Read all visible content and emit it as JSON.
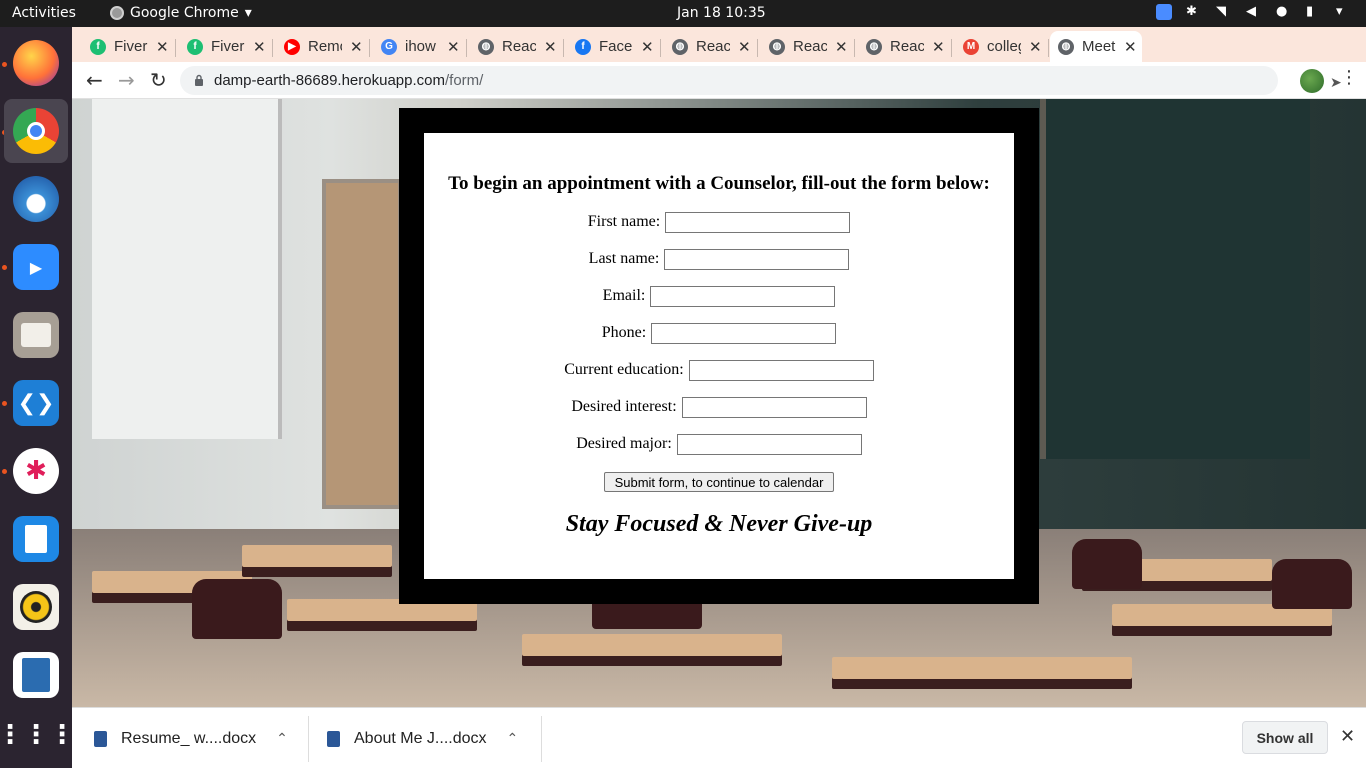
{
  "topbar": {
    "activities": "Activities",
    "app_name": "Google Chrome",
    "clock": "Jan 18  10:35"
  },
  "dock": {
    "items": [
      "firefox",
      "chrome",
      "thunderbird",
      "zoom",
      "files",
      "vscode",
      "slack",
      "whiteboard",
      "rhythmbox",
      "writer",
      "show-apps"
    ]
  },
  "tabs": [
    {
      "label": "Fiverr",
      "icon": "fiverr-icon",
      "color": "#1dbf73",
      "active": false
    },
    {
      "label": "Fiverr",
      "icon": "fiverr-icon",
      "color": "#1dbf73",
      "active": false
    },
    {
      "label": "Remote",
      "icon": "youtube-icon",
      "color": "#ff0000",
      "active": false
    },
    {
      "label": "ihow",
      "icon": "google-icon",
      "color": "#4285f4",
      "active": false
    },
    {
      "label": "React",
      "icon": "globe-icon",
      "color": "#5f6368",
      "active": false
    },
    {
      "label": "Facebook",
      "icon": "facebook-icon",
      "color": "#1877f2",
      "active": false
    },
    {
      "label": "React",
      "icon": "globe-icon",
      "color": "#5f6368",
      "active": false
    },
    {
      "label": "React",
      "icon": "globe-icon",
      "color": "#5f6368",
      "active": false
    },
    {
      "label": "React",
      "icon": "globe-icon",
      "color": "#5f6368",
      "active": false
    },
    {
      "label": "college",
      "icon": "gmail-icon",
      "color": "#ea4335",
      "active": false
    },
    {
      "label": "Meet",
      "icon": "globe-icon",
      "color": "#5f6368",
      "active": true
    }
  ],
  "address_bar": {
    "domain": "damp-earth-86689.herokuapp.com",
    "path": "/form/"
  },
  "form": {
    "heading": "To begin an appointment with a Counselor, fill-out the form below:",
    "fields": [
      {
        "label": "First name:",
        "value": ""
      },
      {
        "label": "Last name:",
        "value": ""
      },
      {
        "label": "Email:",
        "value": ""
      },
      {
        "label": "Phone:",
        "value": ""
      },
      {
        "label": "Current education:",
        "value": ""
      },
      {
        "label": "Desired interest:",
        "value": ""
      },
      {
        "label": "Desired major:",
        "value": ""
      }
    ],
    "submit_label": "Submit form, to continue to calendar",
    "motto": "Stay Focused & Never Give-up"
  },
  "downloads": {
    "items": [
      {
        "name": "Resume_ w....docx"
      },
      {
        "name": "About Me J....docx"
      }
    ],
    "show_all": "Show all"
  }
}
